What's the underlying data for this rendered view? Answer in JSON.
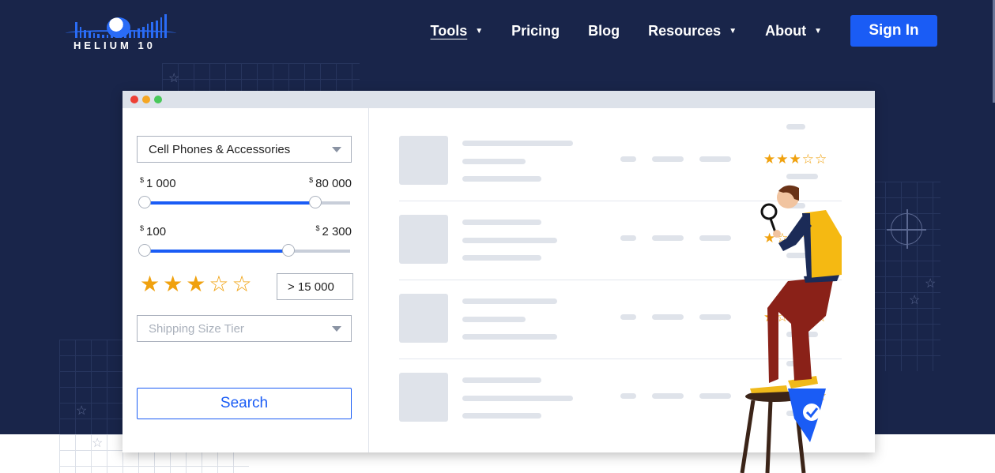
{
  "header": {
    "logo_text": "HELIUM 10",
    "nav": [
      {
        "label": "Tools",
        "has_dropdown": true,
        "active": true
      },
      {
        "label": "Pricing",
        "has_dropdown": false
      },
      {
        "label": "Blog",
        "has_dropdown": false
      },
      {
        "label": "Resources",
        "has_dropdown": true
      },
      {
        "label": "About",
        "has_dropdown": true
      }
    ],
    "sign_in_label": "Sign In"
  },
  "filters": {
    "category_value": "Cell Phones & Accessories",
    "revenue": {
      "currency": "$",
      "min": "1 000",
      "max": "80 000",
      "range_fraction": [
        0,
        0.83
      ]
    },
    "price": {
      "currency": "$",
      "min": "100",
      "max": "2 300",
      "range_fraction": [
        0,
        0.7
      ]
    },
    "rating": {
      "stars": 3,
      "out_of": 5
    },
    "reviews_value": "> 15 000",
    "shipping_placeholder": "Shipping Size Tier",
    "search_label": "Search"
  },
  "results": {
    "rows": 4,
    "row_stars": [
      3,
      1,
      1,
      1
    ]
  },
  "colors": {
    "hero_bg": "#19254a",
    "accent_blue": "#1a5cf5",
    "star": "#f0a10e"
  }
}
